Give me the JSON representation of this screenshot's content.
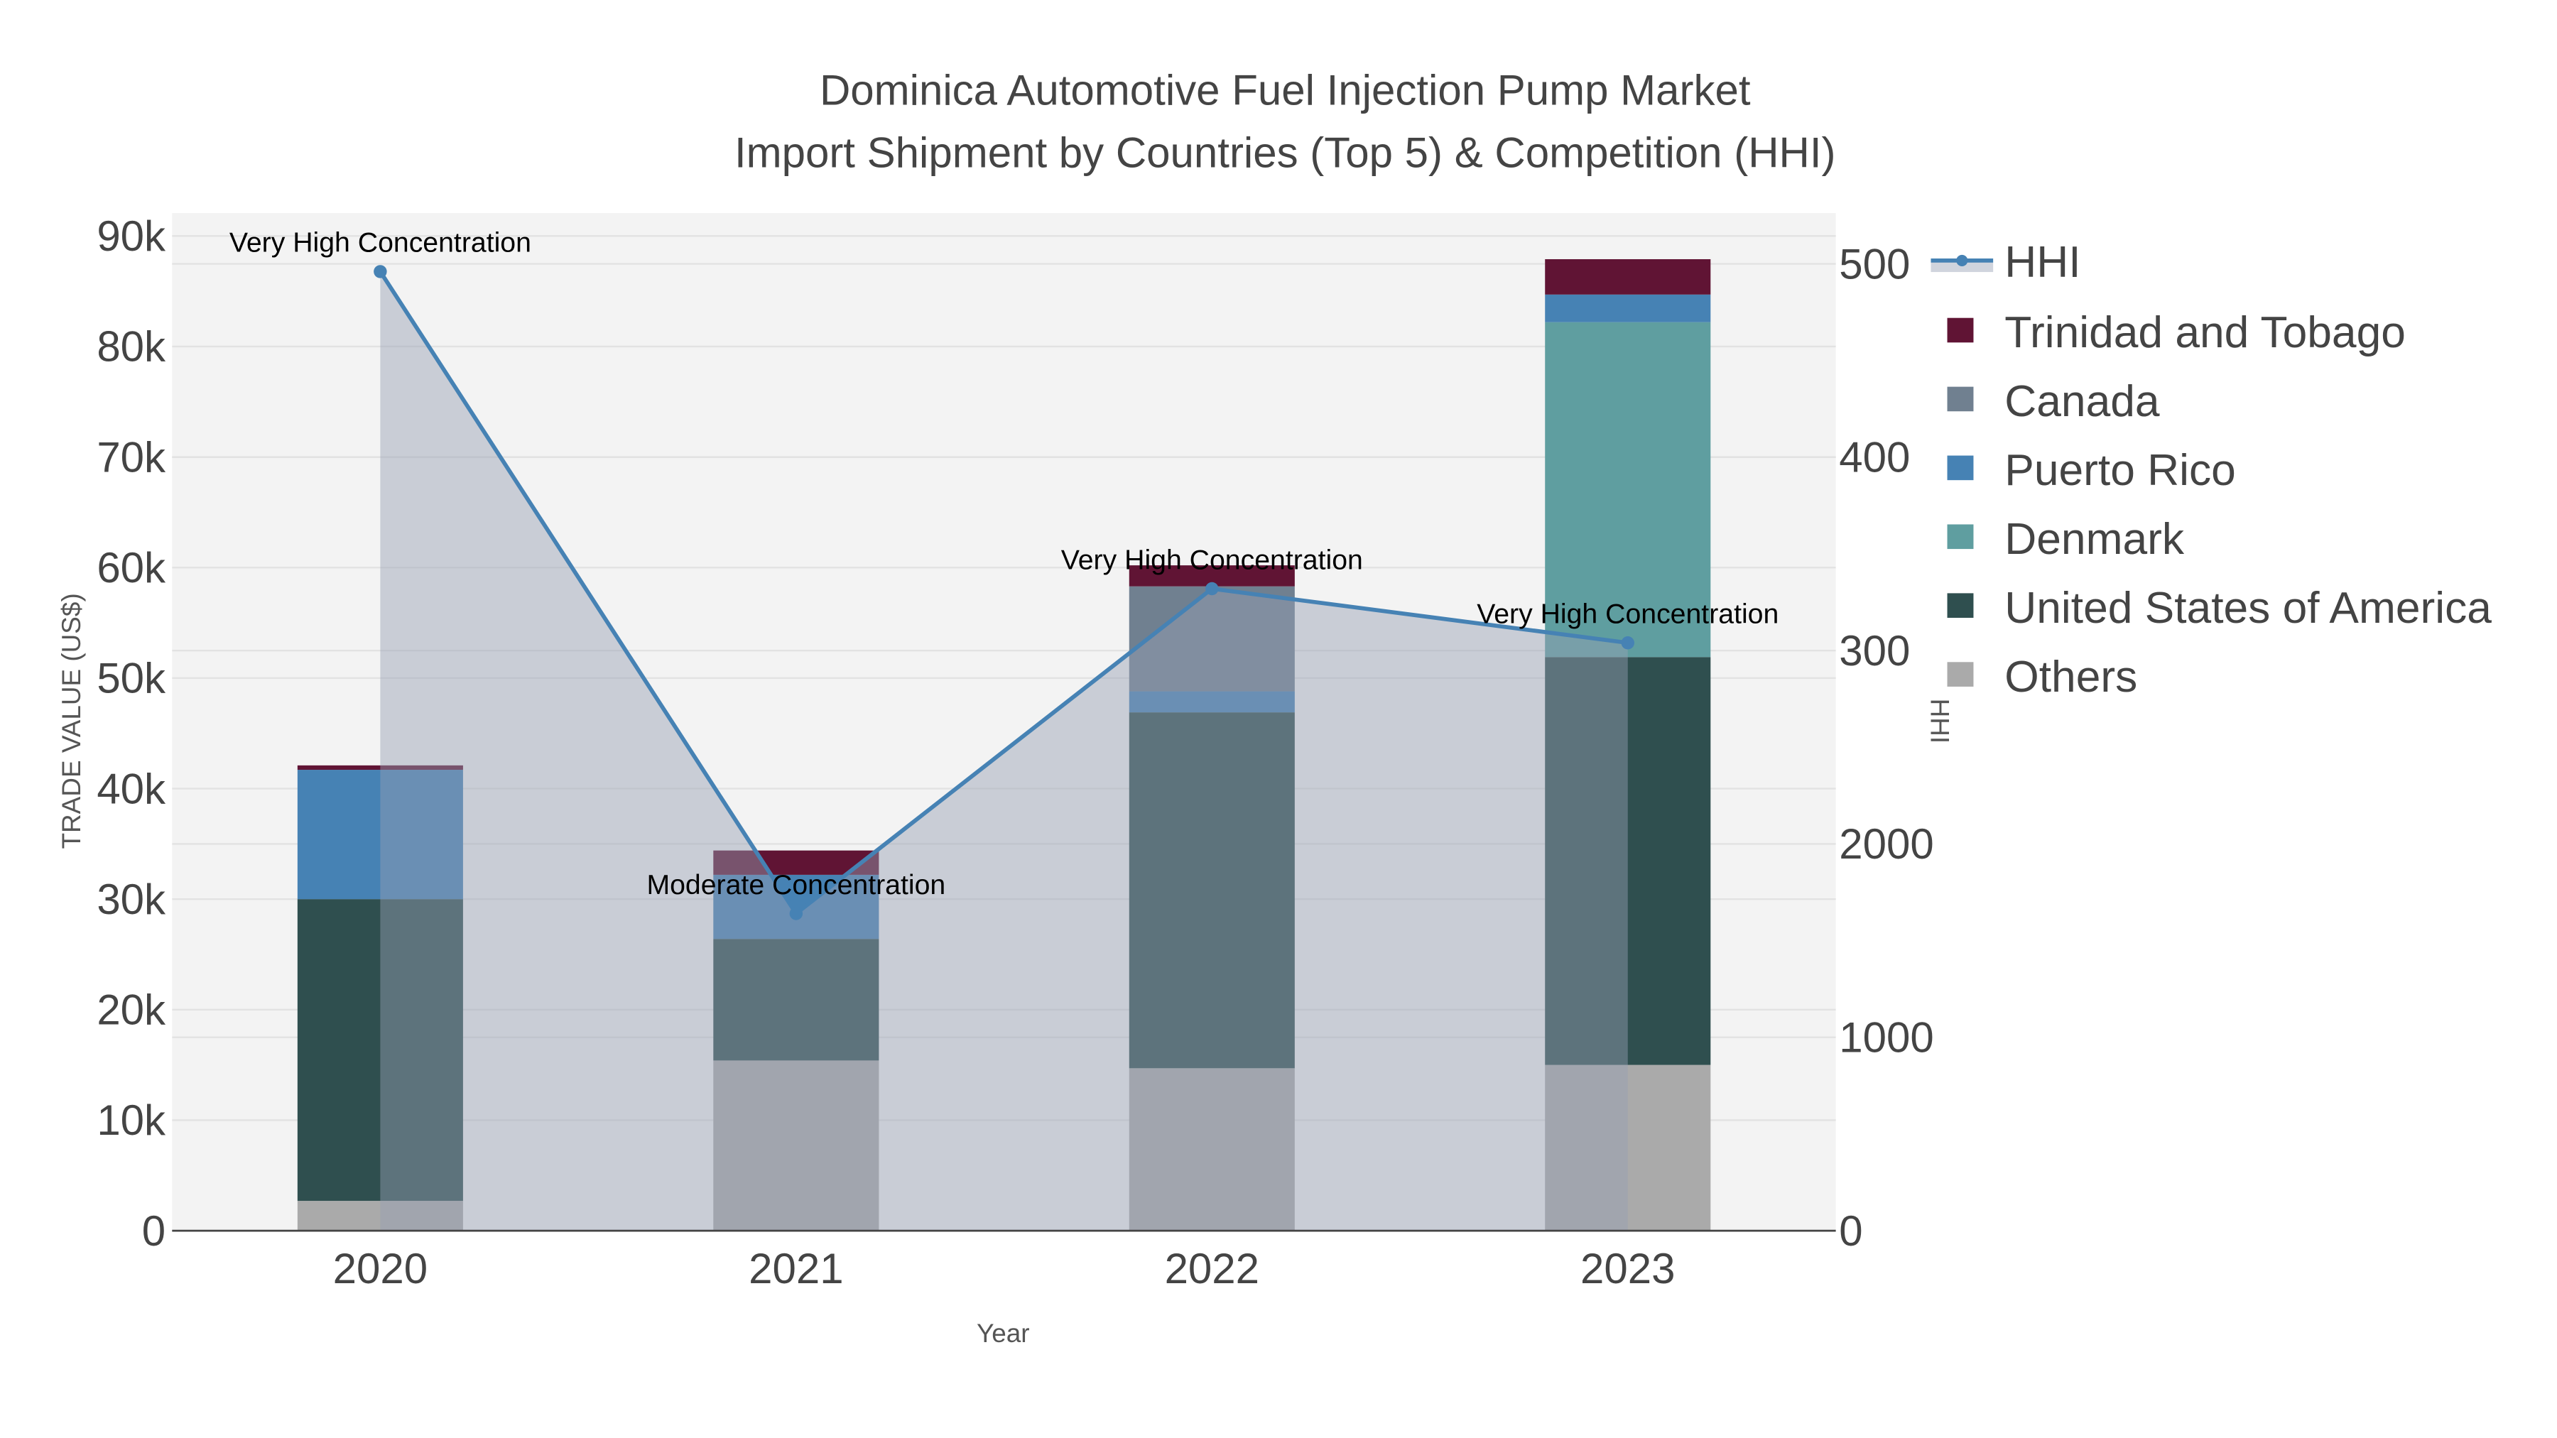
{
  "chart_data": {
    "type": "bar",
    "title": "Dominica Automotive Fuel Injection Pump Market",
    "subtitle": "Import Shipment by Countries (Top 5) & Competition (HHI)",
    "xlabel": "Year",
    "ylabel": "TRADE VALUE (US$)",
    "y2label": "HHI",
    "categories": [
      "2020",
      "2021",
      "2022",
      "2023"
    ],
    "ylim": [
      0,
      92000
    ],
    "y_ticks": [
      0,
      10000,
      20000,
      30000,
      40000,
      50000,
      60000,
      70000,
      80000,
      90000
    ],
    "y_tick_labels": [
      "0",
      "10k",
      "20k",
      "30k",
      "40k",
      "50k",
      "60k",
      "70k",
      "80k",
      "90k"
    ],
    "y2lim": [
      0,
      5200
    ],
    "y2_ticks": [
      0,
      1000,
      2000,
      3000,
      4000,
      5000
    ],
    "y2_tick_labels": [
      "0",
      "1000",
      "2000",
      "300",
      "400",
      "500"
    ],
    "stacked": true,
    "series": [
      {
        "name": "Others",
        "color": "#aaaaaa",
        "values": [
          2700,
          15400,
          14700,
          15000
        ]
      },
      {
        "name": "United States of America",
        "color": "#2f4f4f",
        "values": [
          27300,
          11000,
          32200,
          36900
        ]
      },
      {
        "name": "Denmark",
        "color": "#5f9ea0",
        "values": [
          0,
          0,
          0,
          30300
        ]
      },
      {
        "name": "Puerto Rico",
        "color": "#4682b4",
        "values": [
          11700,
          5800,
          1900,
          2500
        ]
      },
      {
        "name": "Canada",
        "color": "#708090",
        "values": [
          0,
          0,
          9500,
          0
        ]
      },
      {
        "name": "Trinidad and Tobago",
        "color": "#601434",
        "values": [
          400,
          2200,
          1900,
          3200
        ]
      }
    ],
    "line": {
      "name": "HHI",
      "color": "#4682b4",
      "axis": "right",
      "values": [
        4960,
        1640,
        3320,
        3040
      ]
    },
    "annotations": [
      "Very High Concentration",
      "Moderate Concentration",
      "Very High Concentration",
      "Very High Concentration"
    ],
    "legend": [
      "HHI",
      "Trinidad and Tobago",
      "Canada",
      "Puerto Rico",
      "Denmark",
      "United States of America",
      "Others"
    ],
    "legend_position": "right",
    "grid": true
  }
}
